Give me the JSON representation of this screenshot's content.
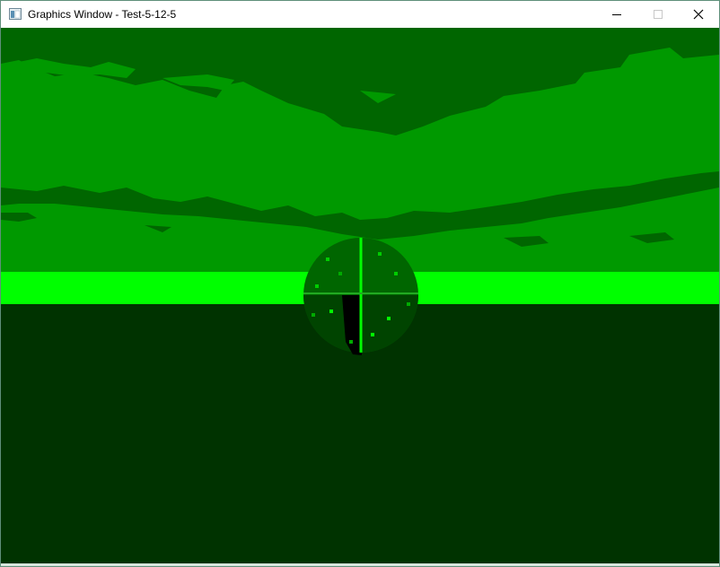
{
  "window": {
    "title": "Graphics Window - Test-5-12-5",
    "app_icon": "app-window-icon",
    "controls": {
      "minimize_icon": "minimize-icon",
      "maximize_icon": "maximize-icon",
      "close_icon": "close-icon"
    }
  },
  "scene": {
    "description_icon": "green-monochrome-3d-render",
    "colors": {
      "sky_cloud": "#006600",
      "sky_mid": "#009900",
      "horizon_band": "#00ff00",
      "ground": "#003300",
      "sphere_dark": "#000000",
      "sphere_mid": "#003300",
      "sphere_light": "#00ff00"
    }
  }
}
